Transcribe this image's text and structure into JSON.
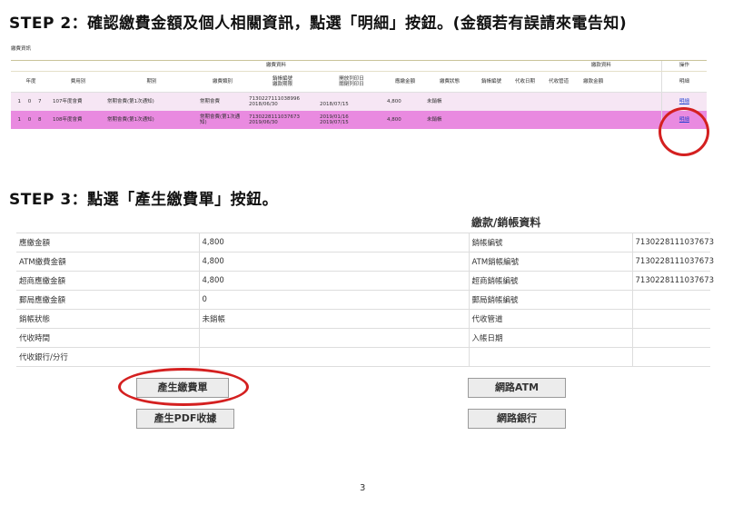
{
  "step2": {
    "title": "STEP 2：確認繳費金額及個人相關資訊，點選「明細」按鈕。(金額若有誤請來電告知)"
  },
  "section_label": "繳費資訊",
  "fee_table": {
    "group_fee": "繳費資料",
    "group_pay": "繳款資料",
    "group_op": "操作",
    "headers": {
      "year": "年度",
      "fee_type": "費用別",
      "period": "期別",
      "fee_category": "繳費類別",
      "account_no": "銷帳編號",
      "account_deadline": "繳款期限",
      "start_date": "開放列印日",
      "close_date": "關閉列印日",
      "amount_due": "應繳金額",
      "status": "繳費狀態",
      "bill_no": "銷帳編號",
      "collect_date": "代收日期",
      "channel": "代收管道",
      "paid_amount": "繳款金額",
      "detail": "明細"
    },
    "rows": [
      {
        "year": "1 0 7",
        "fee_type": "107年度會費",
        "period": "常期會費(第1次通知)",
        "category": "常期會費",
        "account_no": "7130227111038996",
        "deadline": "2018/06/30",
        "open_date": "",
        "close_date": "2018/07/15",
        "amount": "4,800",
        "status": "未銷帳",
        "detail": "明細"
      },
      {
        "year": "1 0 8",
        "fee_type": "108年度會費",
        "period": "常期會費(第1次通知)",
        "category": "常期會費(第1次通知)",
        "account_no": "7130228111037673",
        "deadline": "2019/06/30",
        "open_date": "2019/01/16",
        "close_date": "2019/07/15",
        "amount": "4,800",
        "status": "未銷帳",
        "detail": "明細"
      }
    ]
  },
  "step3": {
    "title": "STEP 3：點選「產生繳費單」按鈕。"
  },
  "detail_panel": {
    "header": "繳款/銷帳資料",
    "left_rows": [
      {
        "label": "應繳金額",
        "value": "4,800"
      },
      {
        "label": "ATM繳費金額",
        "value": "4,800"
      },
      {
        "label": "超商應繳金額",
        "value": "4,800"
      },
      {
        "label": "郵局應繳金額",
        "value": "0"
      },
      {
        "label": "銷帳狀態",
        "value": "未銷帳"
      },
      {
        "label": "代收時間",
        "value": ""
      },
      {
        "label": "代收銀行/分行",
        "value": ""
      }
    ],
    "right_rows": [
      {
        "label": "銷帳編號",
        "value": "7130228111037673"
      },
      {
        "label": "ATM銷帳編號",
        "value": "7130228111037673"
      },
      {
        "label": "超商銷帳編號",
        "value": "7130228111037673"
      },
      {
        "label": "郵局銷帳編號",
        "value": ""
      },
      {
        "label": "代收管道",
        "value": ""
      },
      {
        "label": "入帳日期",
        "value": ""
      }
    ]
  },
  "buttons": {
    "generate_bill": "產生繳費單",
    "generate_pdf": "產生PDF收據",
    "online_atm": "網路ATM",
    "online_bank": "網路銀行"
  },
  "page_number": "3",
  "colors": {
    "highlight_row": "#e98ae0",
    "light_row": "#f6e6f4",
    "annotation_red": "#d42020",
    "link_blue": "#1f3fd0"
  }
}
